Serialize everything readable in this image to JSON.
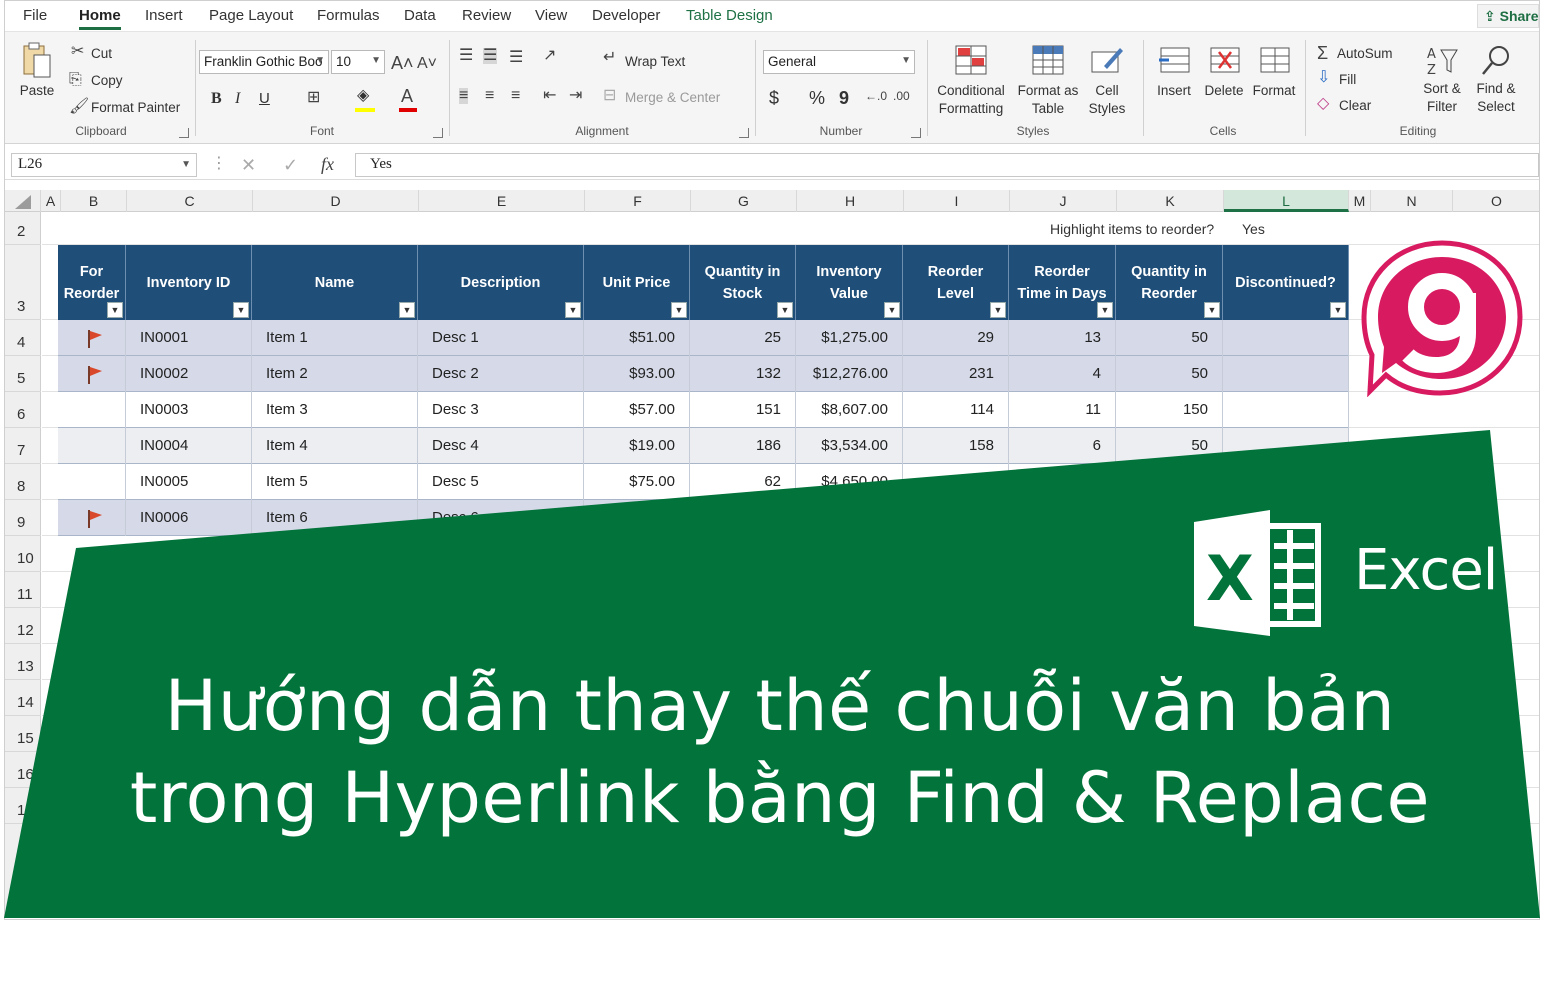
{
  "tabs": [
    "File",
    "Home",
    "Insert",
    "Page Layout",
    "Formulas",
    "Data",
    "Review",
    "View",
    "Developer",
    "Table Design"
  ],
  "share_label": "Share",
  "clipboard": {
    "paste": "Paste",
    "cut": "Cut",
    "copy": "Copy",
    "format_painter": "Format Painter",
    "group": "Clipboard"
  },
  "font": {
    "family": "Franklin Gothic Boo",
    "size": "10",
    "group": "Font",
    "bold": "B",
    "italic": "I",
    "underline": "U"
  },
  "alignment": {
    "wrap_text": "Wrap Text",
    "merge_center": "Merge & Center",
    "group": "Alignment"
  },
  "number": {
    "format": "General",
    "group": "Number",
    "currency": "$",
    "percent": "%",
    "comma": "9"
  },
  "styles": {
    "conditional": [
      "Conditional",
      "Formatting"
    ],
    "format_table": [
      "Format as",
      "Table"
    ],
    "cell_styles": [
      "Cell",
      "Styles"
    ],
    "group": "Styles"
  },
  "cells": {
    "insert": "Insert",
    "delete": "Delete",
    "format": "Format",
    "group": "Cells"
  },
  "editing": {
    "autosum": "AutoSum",
    "fill": "Fill",
    "clear": "Clear",
    "sort_filter": [
      "Sort &",
      "Filter"
    ],
    "find_select": [
      "Find &",
      "Select"
    ],
    "group": "Editing"
  },
  "formula_bar": {
    "name_box": "L26",
    "fx": "fx",
    "value": "Yes"
  },
  "columns": [
    "A",
    "B",
    "C",
    "D",
    "E",
    "F",
    "G",
    "H",
    "I",
    "J",
    "K",
    "L",
    "M",
    "N",
    "O"
  ],
  "rows": [
    "2",
    "3",
    "4",
    "5",
    "6",
    "7",
    "8",
    "9",
    "10",
    "11",
    "12",
    "13",
    "14",
    "15",
    "16",
    "17"
  ],
  "highlight": {
    "label": "Highlight items to reorder?",
    "value": "Yes"
  },
  "table": {
    "headers": [
      [
        "For",
        "Reorder"
      ],
      [
        "Inventory ID"
      ],
      [
        "Name"
      ],
      [
        "Description"
      ],
      [
        "Unit Price"
      ],
      [
        "Quantity in",
        "Stock"
      ],
      [
        "Inventory",
        "Value"
      ],
      [
        "Reorder",
        "Level"
      ],
      [
        "Reorder",
        "Time in Days"
      ],
      [
        "Quantity in",
        "Reorder"
      ],
      [
        "Discontinued?"
      ]
    ],
    "rows": [
      {
        "flag": true,
        "id": "IN0001",
        "name": "Item 1",
        "desc": "Desc 1",
        "price": "$51.00",
        "qty": "25",
        "value": "$1,275.00",
        "level": "29",
        "days": "13",
        "reorder": "50"
      },
      {
        "flag": true,
        "id": "IN0002",
        "name": "Item 2",
        "desc": "Desc 2",
        "price": "$93.00",
        "qty": "132",
        "value": "$12,276.00",
        "level": "231",
        "days": "4",
        "reorder": "50"
      },
      {
        "flag": false,
        "id": "IN0003",
        "name": "Item 3",
        "desc": "Desc 3",
        "price": "$57.00",
        "qty": "151",
        "value": "$8,607.00",
        "level": "114",
        "days": "11",
        "reorder": "150"
      },
      {
        "flag": false,
        "id": "IN0004",
        "name": "Item 4",
        "desc": "Desc 4",
        "price": "$19.00",
        "qty": "186",
        "value": "$3,534.00",
        "level": "158",
        "days": "6",
        "reorder": "50"
      },
      {
        "flag": false,
        "id": "IN0005",
        "name": "Item 5",
        "desc": "Desc 5",
        "price": "$75.00",
        "qty": "62",
        "value": "$4,650.00",
        "level": "",
        "days": "",
        "reorder": ""
      },
      {
        "flag": true,
        "id": "IN0006",
        "name": "Item 6",
        "desc": "Desc 6",
        "price": "",
        "qty": "",
        "value": "",
        "level": "",
        "days": "",
        "reorder": ""
      }
    ]
  },
  "banner": {
    "title_line1": "Hướng dẫn thay thế chuỗi văn bản",
    "title_line2": "trong Hyperlink bằng Find & Replace",
    "excel_word": "Excel",
    "excel_letter": "X",
    "color": "#02733a"
  },
  "colors": {
    "table_header": "#1f4e79",
    "banner_green": "#02733a",
    "logo_pink": "#d81b60",
    "excel_green": "#1e7145"
  }
}
